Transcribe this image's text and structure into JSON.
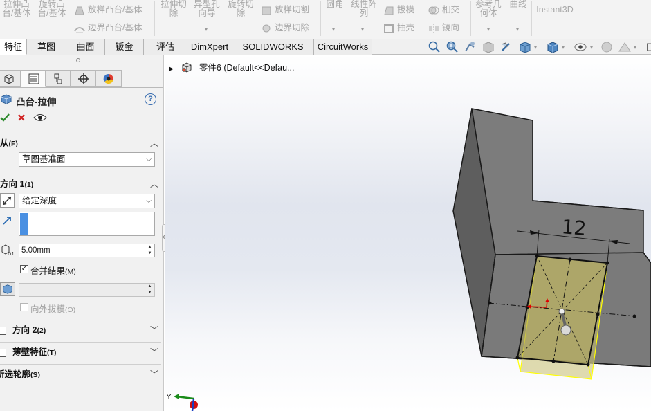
{
  "ribbon": {
    "extrude_boss": "拉伸凸台/基体",
    "revolve_boss": "旋转凸台/基体",
    "sweep_boss": "放样凸台/基体",
    "boundary_boss": "边界凸台/基体",
    "extrude_cut": "拉伸切除",
    "hole_wizard": "异型孔向导",
    "revolve_cut": "旋转切除",
    "loft_cut": "放样切割",
    "boundary_cut": "边界切除",
    "fillet": "圆角",
    "linear_pattern": "线性阵列",
    "draft": "拔模",
    "shell": "抽壳",
    "intersect": "相交",
    "mirror": "镜向",
    "ref_geometry": "参考几何体",
    "curves": "曲线",
    "instant3d": "Instant3D"
  },
  "tabs": [
    "特征",
    "草图",
    "曲面",
    "钣金",
    "评估",
    "DimXpert",
    "SOLIDWORKS MBD",
    "CircuitWorks"
  ],
  "tree": {
    "part_label": "零件6  (Default<<Defau..."
  },
  "panel": {
    "feature_title": "凸台-拉伸",
    "help": "?",
    "from_header": "从",
    "from_hotkey": "(F)",
    "from_value": "草图基准面",
    "dir1_header": "方向 1",
    "dir1_hotkey": "(1)",
    "end_condition": "给定深度",
    "depth_value": "5.00mm",
    "depth_tag": "D1",
    "merge_label": "合并结果",
    "merge_hotkey": "(M)",
    "draft_out_label": "向外拔模",
    "draft_out_hotkey": "(O)",
    "dir2_header": "方向 2",
    "dir2_hotkey": "(2)",
    "thin_header": "薄壁特征",
    "thin_hotkey": "(T)",
    "contours_header": "所选轮廓",
    "contours_hotkey": "(S)"
  },
  "model": {
    "dimension": "12",
    "triad_y": "Y"
  },
  "colors": {
    "accent_blue": "#4a90e2",
    "model_face": "#7a7a7a",
    "preview_yellow": "#c8c070",
    "ok_green": "#2e8b2e",
    "cancel_red": "#d02020"
  },
  "icons": [
    "ok-check-icon",
    "cancel-x-icon",
    "preview-eye-icon",
    "help-icon",
    "feature-manager-icon",
    "property-manager-icon",
    "config-manager-icon",
    "dimxpert-icon",
    "display-manager-icon"
  ]
}
